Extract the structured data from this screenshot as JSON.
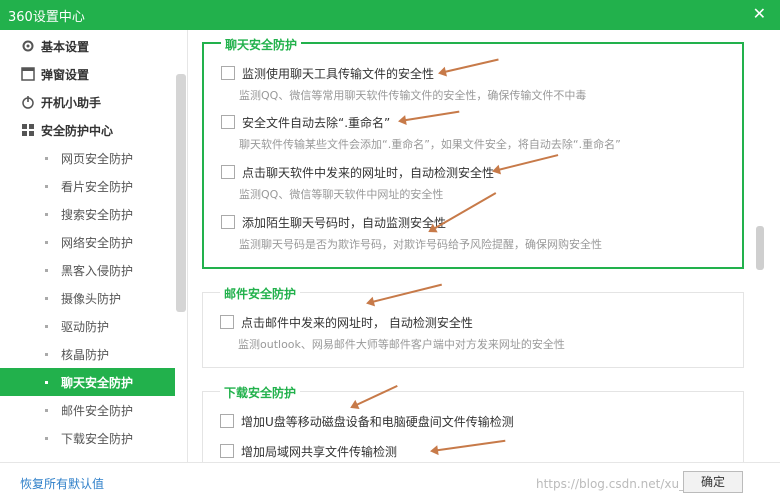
{
  "window": {
    "title": "360设置中心",
    "close_icon": "close-icon"
  },
  "sidebar": {
    "items": [
      {
        "label": "基本设置",
        "icon": "gear-icon"
      },
      {
        "label": "弹窗设置",
        "icon": "window-icon"
      },
      {
        "label": "开机小助手",
        "icon": "power-icon"
      },
      {
        "label": "安全防护中心",
        "icon": "grid-icon"
      },
      {
        "label": "网页安全防护"
      },
      {
        "label": "看片安全防护"
      },
      {
        "label": "搜索安全防护"
      },
      {
        "label": "网络安全防护"
      },
      {
        "label": "黑客入侵防护"
      },
      {
        "label": "摄像头防护"
      },
      {
        "label": "驱动防护"
      },
      {
        "label": "核晶防护"
      },
      {
        "label": "聊天安全防护"
      },
      {
        "label": "邮件安全防护"
      },
      {
        "label": "下载安全防护"
      }
    ],
    "active_label": "聊天安全防护"
  },
  "content": {
    "chat": {
      "title": "聊天安全防护",
      "items": [
        {
          "label": "监测使用聊天工具传输文件的安全性",
          "desc": "监测QQ、微信等常用聊天软件传输文件的安全性，确保传输文件不中毒",
          "checked": false
        },
        {
          "label": "安全文件自动去除“.重命名”",
          "desc": "聊天软件传输某些文件会添加“.重命名”，如果文件安全，将自动去除“.重命名”",
          "checked": false
        },
        {
          "label": "点击聊天软件中发来的网址时，自动检测安全性",
          "desc": "监测QQ、微信等聊天软件中网址的安全性",
          "checked": false
        },
        {
          "label": "添加陌生聊天号码时，自动监测安全性",
          "desc": "监测聊天号码是否为欺诈号码，对欺诈号码给予风险提醒，确保网购安全性",
          "checked": false
        }
      ]
    },
    "mail": {
      "title": "邮件安全防护",
      "items": [
        {
          "label": "点击邮件中发来的网址时， 自动检测安全性",
          "desc": "监测outlook、网易邮件大师等邮件客户端中对方发来网址的安全性",
          "checked": false
        }
      ]
    },
    "download": {
      "title": "下载安全防护",
      "items": [
        {
          "label": "增加U盘等移动磁盘设备和电脑硬盘间文件传输检测",
          "checked": false
        },
        {
          "label": "增加局域网共享文件传输检测",
          "checked": false
        }
      ]
    }
  },
  "footer": {
    "restore_label": "恢复所有默认值",
    "ok_label": "确定",
    "watermark": "https://blog.csdn.net/xu_benjamin"
  },
  "colors": {
    "accent": "#22b14c",
    "arrow": "#c77a49",
    "link": "#2e7fc9"
  }
}
